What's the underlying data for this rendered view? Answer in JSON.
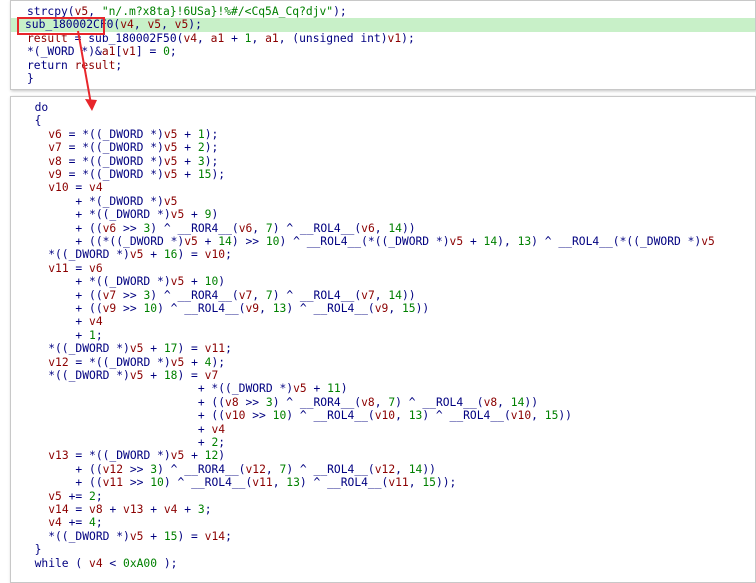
{
  "colors": {
    "default": "#000080",
    "variable": "#8b0000",
    "string": "#008000",
    "number": "#008000",
    "highlight": "#c8f0c8",
    "annotation": "#e8262b"
  },
  "panel_top": {
    "lines": [
      [
        [
          "strcpy(",
          "id"
        ],
        [
          "v5",
          "var"
        ],
        [
          ", ",
          "p"
        ],
        [
          "\"n/.m?x8ta}!6USa}!%#/<Cq5A_Cq?djv\"",
          "str"
        ],
        [
          ");",
          "p"
        ]
      ],
      [
        [
          "sub_180002CF0",
          "fn"
        ],
        [
          "(",
          "p"
        ],
        [
          "v4",
          "var"
        ],
        [
          ", ",
          "p"
        ],
        [
          "v5",
          "var"
        ],
        [
          ", ",
          "p"
        ],
        [
          "v5",
          "var"
        ],
        [
          ");",
          "p"
        ]
      ],
      [
        [
          "result",
          "var"
        ],
        [
          " = sub_180002F50(",
          "fn"
        ],
        [
          "v4",
          "var"
        ],
        [
          ", ",
          "p"
        ],
        [
          "a1",
          "var"
        ],
        [
          " + ",
          "p"
        ],
        [
          "1",
          "num"
        ],
        [
          ", ",
          "p"
        ],
        [
          "a1",
          "var"
        ],
        [
          ", (unsigned int)",
          "kw"
        ],
        [
          "v1",
          "var"
        ],
        [
          ");",
          "p"
        ]
      ],
      [
        [
          "*(_WORD *)&",
          "kw"
        ],
        [
          "a1",
          "var"
        ],
        [
          "[",
          "p"
        ],
        [
          "v1",
          "var"
        ],
        [
          "] = ",
          "p"
        ],
        [
          "0",
          "num"
        ],
        [
          ";",
          "p"
        ]
      ],
      [
        [
          "return ",
          "kw"
        ],
        [
          "result",
          "var"
        ],
        [
          ";",
          "p"
        ]
      ],
      [
        [
          "}",
          "p"
        ]
      ]
    ]
  },
  "panel_bottom": {
    "lines": [
      [
        [
          "  do",
          "kw"
        ]
      ],
      [
        [
          "  {",
          "p"
        ]
      ],
      [
        [
          "    ",
          "p"
        ],
        [
          "v6",
          "var"
        ],
        [
          " = *((_DWORD *)",
          "kw"
        ],
        [
          "v5",
          "var"
        ],
        [
          " + ",
          "p"
        ],
        [
          "1",
          "num"
        ],
        [
          ");",
          "p"
        ]
      ],
      [
        [
          "    ",
          "p"
        ],
        [
          "v7",
          "var"
        ],
        [
          " = *((_DWORD *)",
          "kw"
        ],
        [
          "v5",
          "var"
        ],
        [
          " + ",
          "p"
        ],
        [
          "2",
          "num"
        ],
        [
          ");",
          "p"
        ]
      ],
      [
        [
          "    ",
          "p"
        ],
        [
          "v8",
          "var"
        ],
        [
          " = *((_DWORD *)",
          "kw"
        ],
        [
          "v5",
          "var"
        ],
        [
          " + ",
          "p"
        ],
        [
          "3",
          "num"
        ],
        [
          ");",
          "p"
        ]
      ],
      [
        [
          "    ",
          "p"
        ],
        [
          "v9",
          "var"
        ],
        [
          " = *((_DWORD *)",
          "kw"
        ],
        [
          "v5",
          "var"
        ],
        [
          " + ",
          "p"
        ],
        [
          "15",
          "num"
        ],
        [
          ");",
          "p"
        ]
      ],
      [
        [
          "    ",
          "p"
        ],
        [
          "v10",
          "var"
        ],
        [
          " = ",
          "p"
        ],
        [
          "v4",
          "var"
        ]
      ],
      [
        [
          "        + *(_DWORD *)",
          "kw"
        ],
        [
          "v5",
          "var"
        ]
      ],
      [
        [
          "        + *((_DWORD *)",
          "kw"
        ],
        [
          "v5",
          "var"
        ],
        [
          " + ",
          "p"
        ],
        [
          "9",
          "num"
        ],
        [
          ")",
          "p"
        ]
      ],
      [
        [
          "        + ((",
          "p"
        ],
        [
          "v6",
          "var"
        ],
        [
          " >> ",
          "p"
        ],
        [
          "3",
          "num"
        ],
        [
          ") ^ __ROR4__(",
          "fn"
        ],
        [
          "v6",
          "var"
        ],
        [
          ", ",
          "p"
        ],
        [
          "7",
          "num"
        ],
        [
          ") ^ __ROL4__(",
          "fn"
        ],
        [
          "v6",
          "var"
        ],
        [
          ", ",
          "p"
        ],
        [
          "14",
          "num"
        ],
        [
          "))",
          "p"
        ]
      ],
      [
        [
          "        + ((*((_DWORD *)",
          "kw"
        ],
        [
          "v5",
          "var"
        ],
        [
          " + ",
          "p"
        ],
        [
          "14",
          "num"
        ],
        [
          ") >> ",
          "p"
        ],
        [
          "10",
          "num"
        ],
        [
          ") ^ __ROL4__(*((_DWORD *)",
          "fn"
        ],
        [
          "v5",
          "var"
        ],
        [
          " + ",
          "p"
        ],
        [
          "14",
          "num"
        ],
        [
          "), ",
          "p"
        ],
        [
          "13",
          "num"
        ],
        [
          ") ^ __ROL4__(*((_DWORD *)",
          "fn"
        ],
        [
          "v5",
          "var"
        ]
      ],
      [
        [
          "    *((_DWORD *)",
          "kw"
        ],
        [
          "v5",
          "var"
        ],
        [
          " + ",
          "p"
        ],
        [
          "16",
          "num"
        ],
        [
          ") = ",
          "p"
        ],
        [
          "v10",
          "var"
        ],
        [
          ";",
          "p"
        ]
      ],
      [
        [
          "    ",
          "p"
        ],
        [
          "v11",
          "var"
        ],
        [
          " = ",
          "p"
        ],
        [
          "v6",
          "var"
        ]
      ],
      [
        [
          "        + *((_DWORD *)",
          "kw"
        ],
        [
          "v5",
          "var"
        ],
        [
          " + ",
          "p"
        ],
        [
          "10",
          "num"
        ],
        [
          ")",
          "p"
        ]
      ],
      [
        [
          "        + ((",
          "p"
        ],
        [
          "v7",
          "var"
        ],
        [
          " >> ",
          "p"
        ],
        [
          "3",
          "num"
        ],
        [
          ") ^ __ROR4__(",
          "fn"
        ],
        [
          "v7",
          "var"
        ],
        [
          ", ",
          "p"
        ],
        [
          "7",
          "num"
        ],
        [
          ") ^ __ROL4__(",
          "fn"
        ],
        [
          "v7",
          "var"
        ],
        [
          ", ",
          "p"
        ],
        [
          "14",
          "num"
        ],
        [
          "))",
          "p"
        ]
      ],
      [
        [
          "        + ((",
          "p"
        ],
        [
          "v9",
          "var"
        ],
        [
          " >> ",
          "p"
        ],
        [
          "10",
          "num"
        ],
        [
          ") ^ __ROL4__(",
          "fn"
        ],
        [
          "v9",
          "var"
        ],
        [
          ", ",
          "p"
        ],
        [
          "13",
          "num"
        ],
        [
          ") ^ __ROL4__(",
          "fn"
        ],
        [
          "v9",
          "var"
        ],
        [
          ", ",
          "p"
        ],
        [
          "15",
          "num"
        ],
        [
          "))",
          "p"
        ]
      ],
      [
        [
          "        + ",
          "p"
        ],
        [
          "v4",
          "var"
        ]
      ],
      [
        [
          "        + ",
          "p"
        ],
        [
          "1",
          "num"
        ],
        [
          ";",
          "p"
        ]
      ],
      [
        [
          "    *((_DWORD *)",
          "kw"
        ],
        [
          "v5",
          "var"
        ],
        [
          " + ",
          "p"
        ],
        [
          "17",
          "num"
        ],
        [
          ") = ",
          "p"
        ],
        [
          "v11",
          "var"
        ],
        [
          ";",
          "p"
        ]
      ],
      [
        [
          "    ",
          "p"
        ],
        [
          "v12",
          "var"
        ],
        [
          " = *((_DWORD *)",
          "kw"
        ],
        [
          "v5",
          "var"
        ],
        [
          " + ",
          "p"
        ],
        [
          "4",
          "num"
        ],
        [
          ");",
          "p"
        ]
      ],
      [
        [
          "    *((_DWORD *)",
          "kw"
        ],
        [
          "v5",
          "var"
        ],
        [
          " + ",
          "p"
        ],
        [
          "18",
          "num"
        ],
        [
          ") = ",
          "p"
        ],
        [
          "v7",
          "var"
        ]
      ],
      [
        [
          "                          + *((_DWORD *)",
          "kw"
        ],
        [
          "v5",
          "var"
        ],
        [
          " + ",
          "p"
        ],
        [
          "11",
          "num"
        ],
        [
          ")",
          "p"
        ]
      ],
      [
        [
          "                          + ((",
          "p"
        ],
        [
          "v8",
          "var"
        ],
        [
          " >> ",
          "p"
        ],
        [
          "3",
          "num"
        ],
        [
          ") ^ __ROR4__(",
          "fn"
        ],
        [
          "v8",
          "var"
        ],
        [
          ", ",
          "p"
        ],
        [
          "7",
          "num"
        ],
        [
          ") ^ __ROL4__(",
          "fn"
        ],
        [
          "v8",
          "var"
        ],
        [
          ", ",
          "p"
        ],
        [
          "14",
          "num"
        ],
        [
          "))",
          "p"
        ]
      ],
      [
        [
          "                          + ((",
          "p"
        ],
        [
          "v10",
          "var"
        ],
        [
          " >> ",
          "p"
        ],
        [
          "10",
          "num"
        ],
        [
          ") ^ __ROL4__(",
          "fn"
        ],
        [
          "v10",
          "var"
        ],
        [
          ", ",
          "p"
        ],
        [
          "13",
          "num"
        ],
        [
          ") ^ __ROL4__(",
          "fn"
        ],
        [
          "v10",
          "var"
        ],
        [
          ", ",
          "p"
        ],
        [
          "15",
          "num"
        ],
        [
          "))",
          "p"
        ]
      ],
      [
        [
          "                          + ",
          "p"
        ],
        [
          "v4",
          "var"
        ]
      ],
      [
        [
          "                          + ",
          "p"
        ],
        [
          "2",
          "num"
        ],
        [
          ";",
          "p"
        ]
      ],
      [
        [
          "    ",
          "p"
        ],
        [
          "v13",
          "var"
        ],
        [
          " = *((_DWORD *)",
          "kw"
        ],
        [
          "v5",
          "var"
        ],
        [
          " + ",
          "p"
        ],
        [
          "12",
          "num"
        ],
        [
          ")",
          "p"
        ]
      ],
      [
        [
          "        + ((",
          "p"
        ],
        [
          "v12",
          "var"
        ],
        [
          " >> ",
          "p"
        ],
        [
          "3",
          "num"
        ],
        [
          ") ^ __ROR4__(",
          "fn"
        ],
        [
          "v12",
          "var"
        ],
        [
          ", ",
          "p"
        ],
        [
          "7",
          "num"
        ],
        [
          ") ^ __ROL4__(",
          "fn"
        ],
        [
          "v12",
          "var"
        ],
        [
          ", ",
          "p"
        ],
        [
          "14",
          "num"
        ],
        [
          "))",
          "p"
        ]
      ],
      [
        [
          "        + ((",
          "p"
        ],
        [
          "v11",
          "var"
        ],
        [
          " >> ",
          "p"
        ],
        [
          "10",
          "num"
        ],
        [
          ") ^ __ROL4__(",
          "fn"
        ],
        [
          "v11",
          "var"
        ],
        [
          ", ",
          "p"
        ],
        [
          "13",
          "num"
        ],
        [
          ") ^ __ROL4__(",
          "fn"
        ],
        [
          "v11",
          "var"
        ],
        [
          ", ",
          "p"
        ],
        [
          "15",
          "num"
        ],
        [
          "));",
          "p"
        ]
      ],
      [
        [
          "    ",
          "p"
        ],
        [
          "v5",
          "var"
        ],
        [
          " += ",
          "p"
        ],
        [
          "2",
          "num"
        ],
        [
          ";",
          "p"
        ]
      ],
      [
        [
          "    ",
          "p"
        ],
        [
          "v14",
          "var"
        ],
        [
          " = ",
          "p"
        ],
        [
          "v8",
          "var"
        ],
        [
          " + ",
          "p"
        ],
        [
          "v13",
          "var"
        ],
        [
          " + ",
          "p"
        ],
        [
          "v4",
          "var"
        ],
        [
          " + ",
          "p"
        ],
        [
          "3",
          "num"
        ],
        [
          ";",
          "p"
        ]
      ],
      [
        [
          "    ",
          "p"
        ],
        [
          "v4",
          "var"
        ],
        [
          " += ",
          "p"
        ],
        [
          "4",
          "num"
        ],
        [
          ";",
          "p"
        ]
      ],
      [
        [
          "    *((_DWORD *)",
          "kw"
        ],
        [
          "v5",
          "var"
        ],
        [
          " + ",
          "p"
        ],
        [
          "15",
          "num"
        ],
        [
          ") = ",
          "p"
        ],
        [
          "v14",
          "var"
        ],
        [
          ";",
          "p"
        ]
      ],
      [
        [
          "  }",
          "p"
        ]
      ],
      [
        [
          "  while ( ",
          "kw"
        ],
        [
          "v4",
          "var"
        ],
        [
          " < ",
          "p"
        ],
        [
          "0xA00",
          "num"
        ],
        [
          " );",
          "p"
        ]
      ]
    ]
  }
}
